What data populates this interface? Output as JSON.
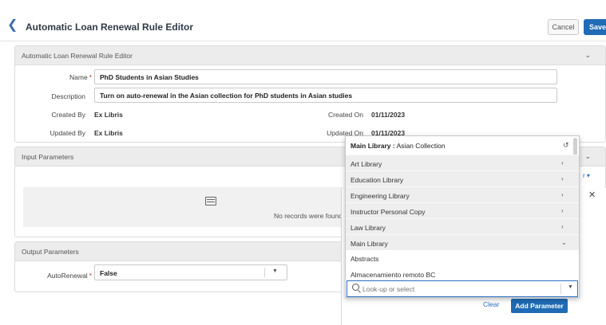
{
  "header": {
    "back_icon": "chevron-left-icon",
    "title": "Automatic Loan Renewal Rule Editor",
    "cancel_label": "Cancel",
    "save_label": "Save"
  },
  "general_section": {
    "title": "Automatic Loan Renewal Rule Editor",
    "name_label": "Name",
    "name_value": "PhD Students in Asian Studies",
    "description_label": "Description",
    "description_value": "Turn on auto-renewal in the Asian collection for PhD students in Asian studies",
    "created_by_label": "Created By",
    "created_by_value": "Ex Libris",
    "created_on_label": "Created On",
    "created_on_value": "01/11/2023",
    "updated_by_label": "Updated By",
    "updated_by_value": "Ex Libris",
    "updated_on_label": "Updated On",
    "updated_on_value": "01/11/2023"
  },
  "input_section": {
    "title": "Input Parameters",
    "empty_text": "No records were found"
  },
  "output_section": {
    "title": "Output Parameters",
    "autorenewal_label": "AutoRenewal",
    "autorenewal_value": "False"
  },
  "side_panel": {
    "clear_label": "Clear",
    "add_label": "Add Parameter"
  },
  "dropdown": {
    "selected_label": "Main Library :",
    "selected_value": "Asian Collection",
    "groups": [
      {
        "label": "Art Library",
        "expanded": false
      },
      {
        "label": "Education Library",
        "expanded": false
      },
      {
        "label": "Engineering Library",
        "expanded": false
      },
      {
        "label": "Instructor Personal Copy",
        "expanded": false
      },
      {
        "label": "Law Library",
        "expanded": false
      },
      {
        "label": "Main Library",
        "expanded": true
      }
    ],
    "sub_items": [
      "Abstracts",
      "Almacenamiento remoto BC"
    ],
    "search_placeholder": "Look-up or select"
  },
  "colors": {
    "primary": "#1f6bb5",
    "link": "#2a6fc0",
    "required": "#c0392b",
    "section_header": "#ececec"
  }
}
